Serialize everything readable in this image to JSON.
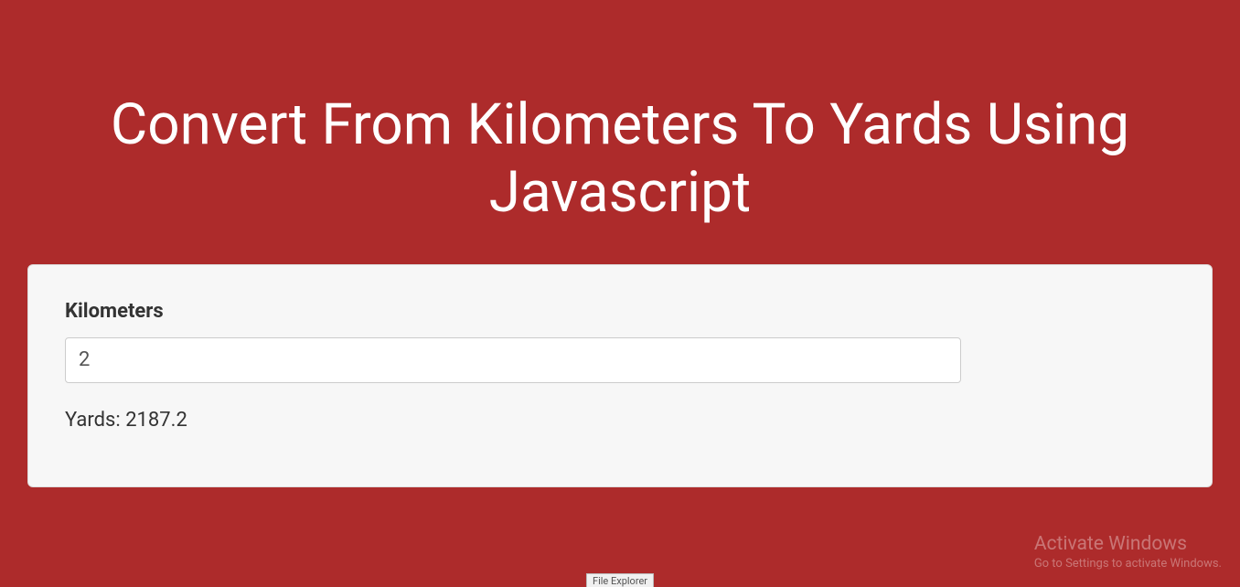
{
  "header": {
    "title": "Convert From Kilometers To Yards Using Javascript"
  },
  "form": {
    "input_label": "Kilometers",
    "input_value": "2",
    "result_text": "Yards: 2187.2"
  },
  "watermark": {
    "title": "Activate Windows",
    "subtitle": "Go to Settings to activate Windows."
  },
  "taskbar": {
    "hint": "File Explorer"
  }
}
